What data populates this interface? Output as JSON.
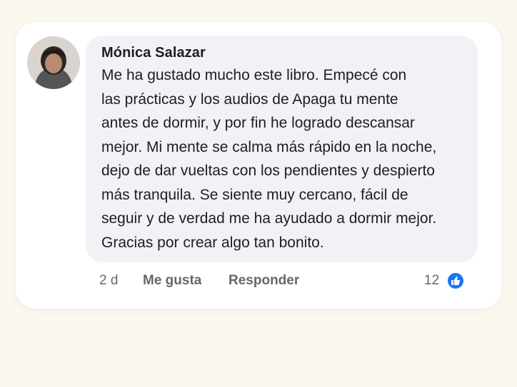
{
  "comment": {
    "author": "Mónica Salazar",
    "lines": [
      "Me ha gustado mucho este libro. Empecé con",
      "las prácticas y los audios de Apaga tu mente",
      "antes de dormir, y por fin he logrado descansar",
      "mejor. Mi mente se calma más rápido en la noche,",
      "dejo de dar vueltas con los pendientes y despierto",
      "más tranquila. Se siente muy cercano, fácil de",
      "seguir y de verdad me ha ayudado a dormir mejor.",
      "Gracias por crear algo tan bonito."
    ],
    "time": "2 d",
    "like_label": "Me gusta",
    "reply_label": "Responder",
    "reaction_count": "12",
    "reaction_icon": "thumbs-up-icon",
    "reaction_color": "#1877f2"
  }
}
